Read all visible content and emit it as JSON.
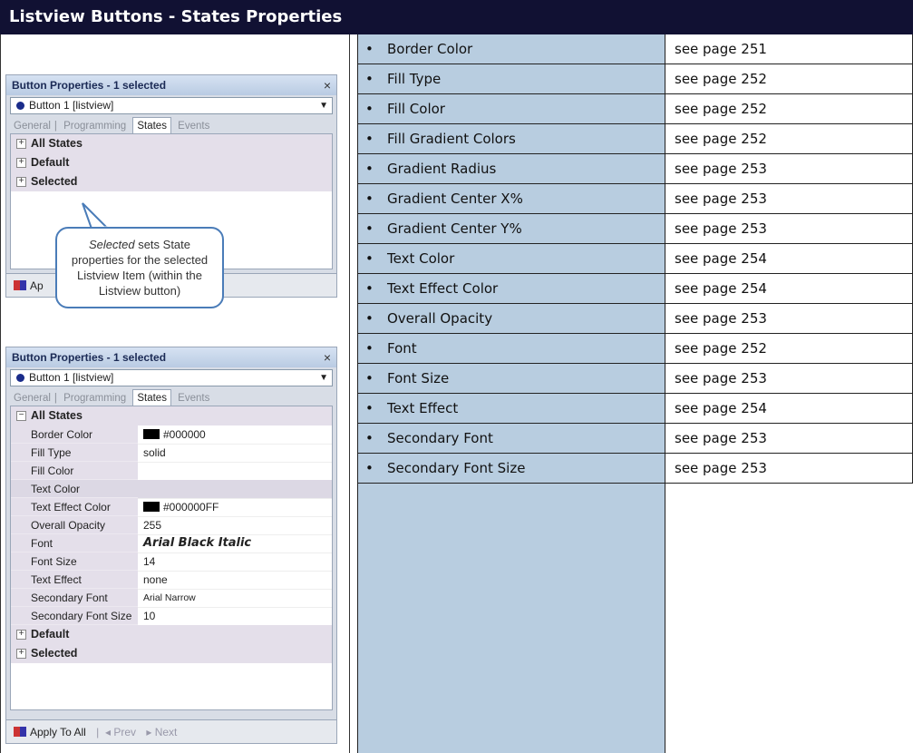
{
  "title": "Listview Buttons - States Properties",
  "rows": [
    {
      "name": "Border Color",
      "ref": "see page 251"
    },
    {
      "name": "Fill Type",
      "ref": "see page 252"
    },
    {
      "name": "Fill Color",
      "ref": "see page 252"
    },
    {
      "name": "Fill Gradient Colors",
      "ref": "see page 252"
    },
    {
      "name": "Gradient Radius",
      "ref": "see page 253"
    },
    {
      "name": "Gradient Center X%",
      "ref": "see page 253"
    },
    {
      "name": "Gradient Center Y%",
      "ref": "see page 253"
    },
    {
      "name": "Text Color",
      "ref": "see page 254"
    },
    {
      "name": "Text Effect Color",
      "ref": "see page 254"
    },
    {
      "name": "Overall Opacity",
      "ref": "see page 253"
    },
    {
      "name": "Font",
      "ref": "see page 252"
    },
    {
      "name": "Font Size",
      "ref": "see page 253"
    },
    {
      "name": "Text Effect",
      "ref": "see page 254"
    },
    {
      "name": "Secondary Font",
      "ref": "see page 253"
    },
    {
      "name": "Secondary Font Size",
      "ref": "see page 253"
    }
  ],
  "panel1": {
    "title": "Button Properties - 1 selected",
    "close": "×",
    "select": "Button 1  [listview]",
    "tabs": [
      "General",
      "Programming",
      "States",
      "Events"
    ],
    "groups": [
      "All States",
      "Default",
      "Selected"
    ],
    "footer_apply": "Ap"
  },
  "callout": {
    "em": "Selected",
    "text1": " sets State",
    "text2": "properties for the selected",
    "text3": "Listview Item (within the",
    "text4": "Listview button)"
  },
  "panel2": {
    "title": "Button Properties - 1 selected",
    "close": "×",
    "select": "Button 1  [listview]",
    "tabs": [
      "General",
      "Programming",
      "States",
      "Events"
    ],
    "group_open": "All States",
    "props": [
      {
        "k": "Border Color",
        "v": "#000000"
      },
      {
        "k": "Fill Type",
        "v": "solid"
      },
      {
        "k": "Fill Color",
        "v": ""
      },
      {
        "k": "Text Color",
        "v": ""
      },
      {
        "k": "Text Effect Color",
        "v": "#000000FF"
      },
      {
        "k": "Overall Opacity",
        "v": "255"
      },
      {
        "k": "Font",
        "v": "Arial Black Italic"
      },
      {
        "k": "Font Size",
        "v": "14"
      },
      {
        "k": "Text Effect",
        "v": "none"
      },
      {
        "k": "Secondary Font",
        "v": "Arial Narrow"
      },
      {
        "k": "Secondary Font Size",
        "v": "10"
      }
    ],
    "groups_closed": [
      "Default",
      "Selected"
    ],
    "footer_apply": "Apply To All",
    "footer_prev": "Prev",
    "footer_next": "Next"
  }
}
